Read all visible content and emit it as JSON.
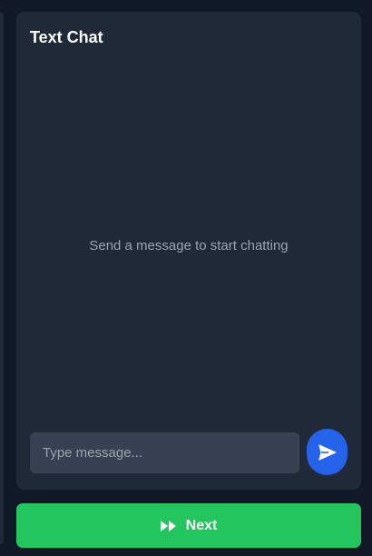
{
  "chat": {
    "title": "Text Chat",
    "empty_hint": "Send a message to start chatting",
    "input_placeholder": "Type message...",
    "input_value": "",
    "send_icon": "send-icon"
  },
  "footer": {
    "next_label": "Next",
    "next_icon": "fast-forward-icon"
  },
  "colors": {
    "background": "#111827",
    "panel": "#1f2937",
    "input": "#374151",
    "send_accent": "#2563eb",
    "next_accent": "#22c55e",
    "hint_text": "#9ca3af"
  }
}
